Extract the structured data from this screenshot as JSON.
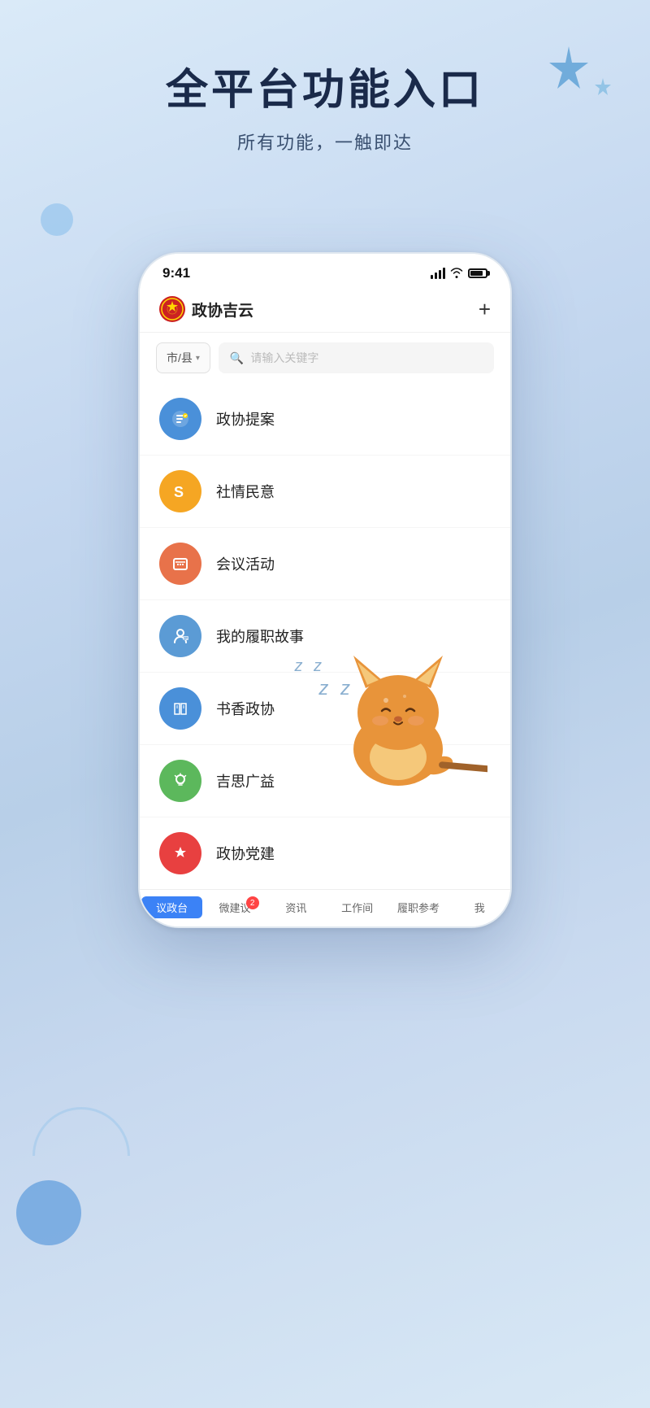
{
  "hero": {
    "title": "全平台功能入口",
    "subtitle": "所有功能，一触即达"
  },
  "phone": {
    "status": {
      "time": "9:41",
      "signal_label": "signal",
      "wifi_label": "wifi",
      "battery_label": "battery"
    },
    "header": {
      "app_name": "政协吉云",
      "plus_label": "+"
    },
    "search": {
      "location_label": "市/县",
      "placeholder": "请输入关键字"
    },
    "menu_items": [
      {
        "label": "政协提案",
        "icon_color": "#4a90d9",
        "icon_type": "proposal"
      },
      {
        "label": "社情民意",
        "icon_color": "#f5a623",
        "icon_type": "social"
      },
      {
        "label": "会议活动",
        "icon_color": "#e8724a",
        "icon_type": "meeting"
      },
      {
        "label": "我的履职故事",
        "icon_color": "#5b9bd5",
        "icon_type": "story"
      },
      {
        "label": "书香政协",
        "icon_color": "#4a90d9",
        "icon_type": "book"
      },
      {
        "label": "吉思广益",
        "icon_color": "#5cb85c",
        "icon_type": "idea"
      },
      {
        "label": "政协党建",
        "icon_color": "#e84040",
        "icon_type": "party"
      }
    ],
    "tabs": [
      {
        "label": "议政台",
        "active": true,
        "badge": null
      },
      {
        "label": "微建议",
        "active": false,
        "badge": "2"
      },
      {
        "label": "资讯",
        "active": false,
        "badge": null
      },
      {
        "label": "工作间",
        "active": false,
        "badge": null
      },
      {
        "label": "履职参考",
        "active": false,
        "badge": null
      },
      {
        "label": "我",
        "active": false,
        "badge": null
      }
    ]
  },
  "mascot": {
    "zzz": "z z"
  }
}
